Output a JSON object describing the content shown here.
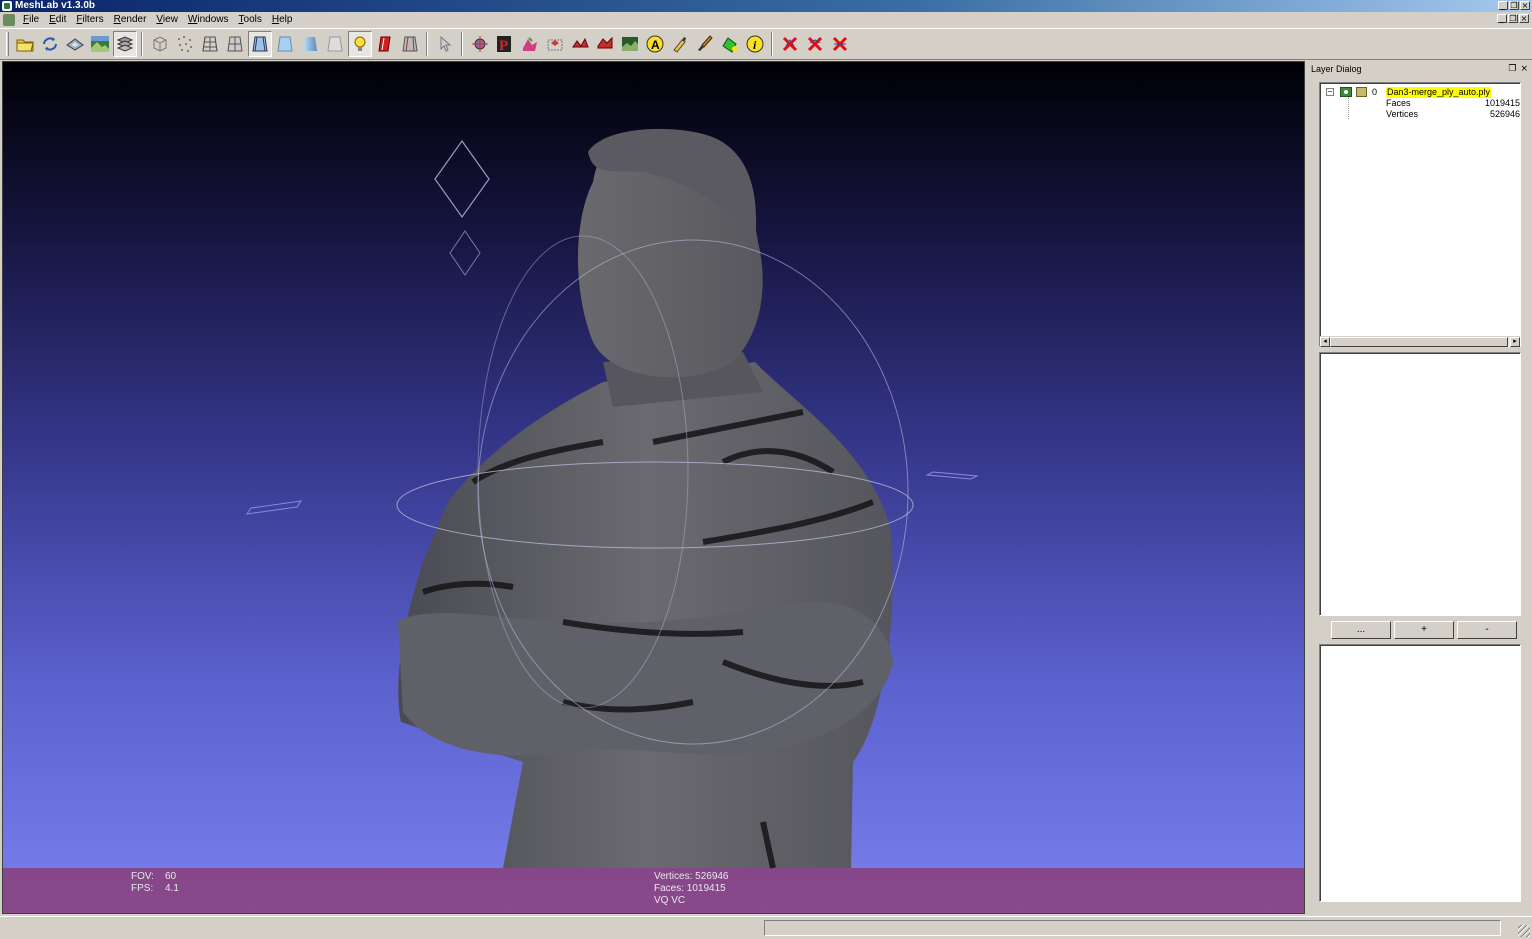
{
  "window": {
    "title": "MeshLab v1.3.0b"
  },
  "menu": [
    {
      "label": "File",
      "ul": "F",
      "rest": "ile"
    },
    {
      "label": "Edit",
      "ul": "E",
      "rest": "dit"
    },
    {
      "label": "Filters",
      "ul": "F",
      "rest": "ilters"
    },
    {
      "label": "Render",
      "ul": "R",
      "rest": "ender"
    },
    {
      "label": "View",
      "ul": "V",
      "rest": "iew"
    },
    {
      "label": "Windows",
      "ul": "W",
      "rest": "indows"
    },
    {
      "label": "Tools",
      "ul": "T",
      "rest": "ools"
    },
    {
      "label": "Help",
      "ul": "H",
      "rest": "elp"
    }
  ],
  "viewport": {
    "fov_label": "FOV:",
    "fov_value": "60",
    "fps_label": "FPS:",
    "fps_value": "4.1",
    "vertices_text": "Vertices: 526946",
    "faces_text": "Faces: 1019415",
    "mode_text": "VQ VC"
  },
  "layer_dialog": {
    "title": "Layer Dialog",
    "layer": {
      "index": "0",
      "name": "Dan3-merge_ply_auto.ply",
      "faces_label": "Faces",
      "faces_value": "1019415",
      "vertices_label": "Vertices",
      "vertices_value": "526946"
    },
    "buttons": {
      "more": "...",
      "add": "+",
      "remove": "-"
    }
  },
  "colors": {
    "titlebar": "#0a246a",
    "chrome": "#d4d0c8",
    "layer_highlight": "#ffff00",
    "info_overlay": "#961e3c"
  }
}
